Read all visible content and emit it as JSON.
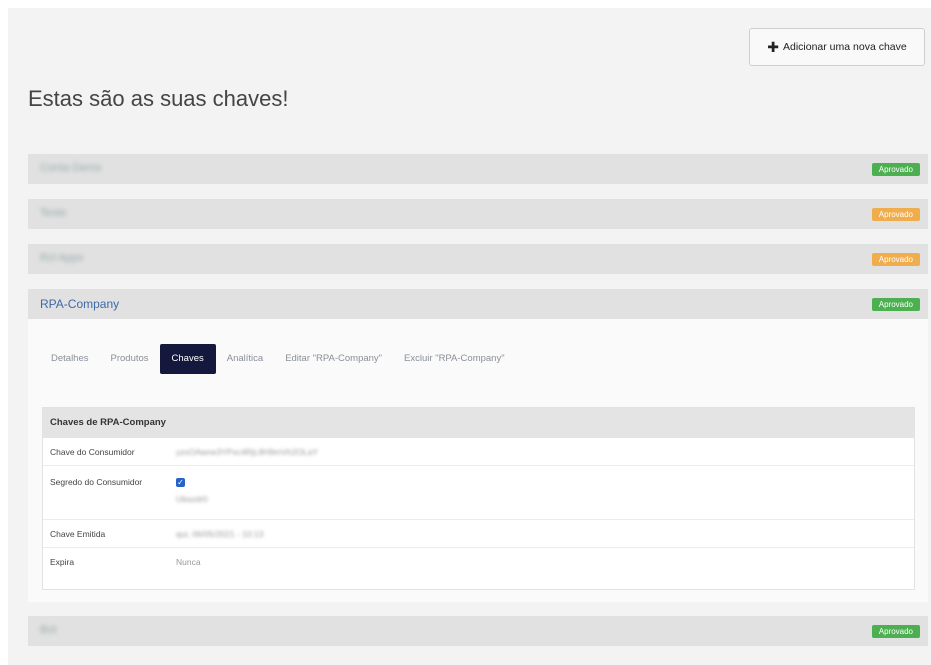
{
  "header": {
    "add_button_label": "Adicionar uma nova chave",
    "page_title": "Estas são as suas chaves!"
  },
  "apps": [
    {
      "name": "Conta Demo",
      "status": "Aprovado",
      "status_color": "#4caf50"
    },
    {
      "name": "Teste",
      "status": "Aprovado",
      "status_color": "#f0ad4e"
    },
    {
      "name": "Rcl Apps",
      "status": "Aprovado",
      "status_color": "#f0ad4e"
    },
    {
      "name": "RPA-Company",
      "status": "Aprovado",
      "status_color": "#4caf50"
    },
    {
      "name": "Bot",
      "status": "Aprovado",
      "status_color": "#4caf50"
    }
  ],
  "tabs": [
    {
      "label": "Detalhes"
    },
    {
      "label": "Produtos"
    },
    {
      "label": "Chaves"
    },
    {
      "label": "Analítica"
    },
    {
      "label": "Editar \"RPA-Company\""
    },
    {
      "label": "Excluir \"RPA-Company\""
    }
  ],
  "keys": {
    "panel_title": "Chaves de RPA-Company",
    "consumer_key_label": "Chave do Consumidor",
    "consumer_key_value": "yzxOAwne3YPxc4RjL8H9mVh2OLaY",
    "consumer_secret_label": "Segredo do Consumidor",
    "consumer_secret_value": "Ubszdr0",
    "issued_label": "Chave Emitida",
    "issued_value": "qui, 06/05/2021 - 10:13",
    "expires_label": "Expira",
    "expires_value": "Nunca"
  },
  "icons": {
    "add": "plus-icon",
    "checkbox": "checkbox-checked-icon"
  }
}
